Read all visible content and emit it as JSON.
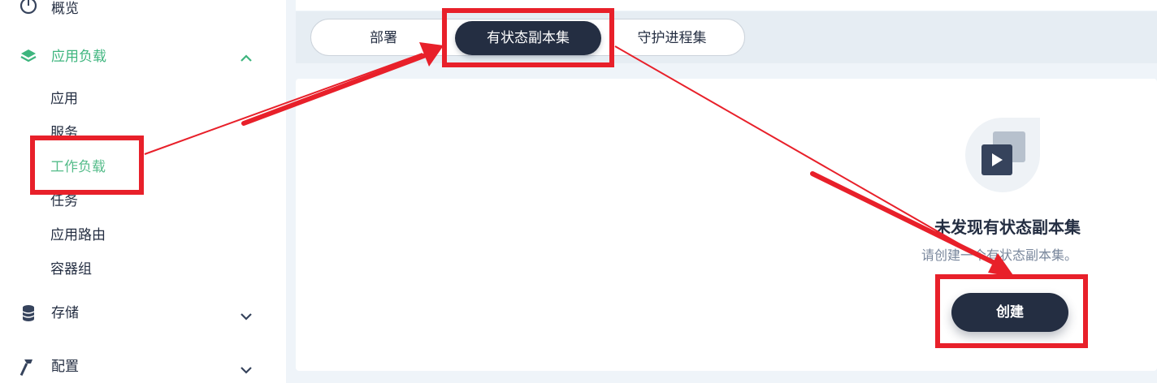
{
  "sidebar": {
    "overview": {
      "label": "概览",
      "icon": "dashboard-icon"
    },
    "workloads_group": {
      "label": "应用负载",
      "icon": "layers-icon",
      "expanded": true
    },
    "workloads_items": [
      {
        "label": "应用"
      },
      {
        "label": "服务"
      },
      {
        "label": "工作负载",
        "active": true
      },
      {
        "label": "任务"
      },
      {
        "label": "应用路由"
      },
      {
        "label": "容器组"
      }
    ],
    "storage_group": {
      "label": "存储",
      "icon": "database-icon"
    },
    "config_group": {
      "label": "配置",
      "icon": "hammer-icon"
    }
  },
  "tabs": [
    {
      "label": "部署"
    },
    {
      "label": "有状态副本集",
      "active": true
    },
    {
      "label": "守护进程集"
    }
  ],
  "empty_state": {
    "title": "未发现有状态副本集",
    "description": "请创建一个有状态副本集。",
    "icon": "play-window-icon",
    "create_label": "创建"
  },
  "colors": {
    "accent_green": "#55bc8a",
    "dark": "#242e42",
    "annotation_red": "#e8202a"
  }
}
